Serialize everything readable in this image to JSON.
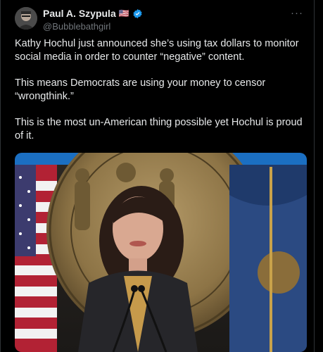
{
  "author": {
    "display_name": "Paul A. Szypula",
    "flag": "🇺🇸",
    "handle": "@Bubblebathgirl",
    "avatar_icon": "avatar-photo",
    "verified_icon": "verified-badge-icon",
    "verified_color": "#1d9bf0"
  },
  "tweet": {
    "paragraphs": [
      "Kathy Hochul just announced she’s using tax dollars to monitor social media in order to counter “negative” content.",
      "This means Democrats are using your money to censor “wrongthink.”",
      "This is the most un-American thing possible yet Hochul is proud of it."
    ]
  },
  "more_menu": "···",
  "colors": {
    "background": "#000000",
    "text": "#e7e9ea",
    "muted": "#71767b",
    "accent": "#1d9bf0"
  }
}
